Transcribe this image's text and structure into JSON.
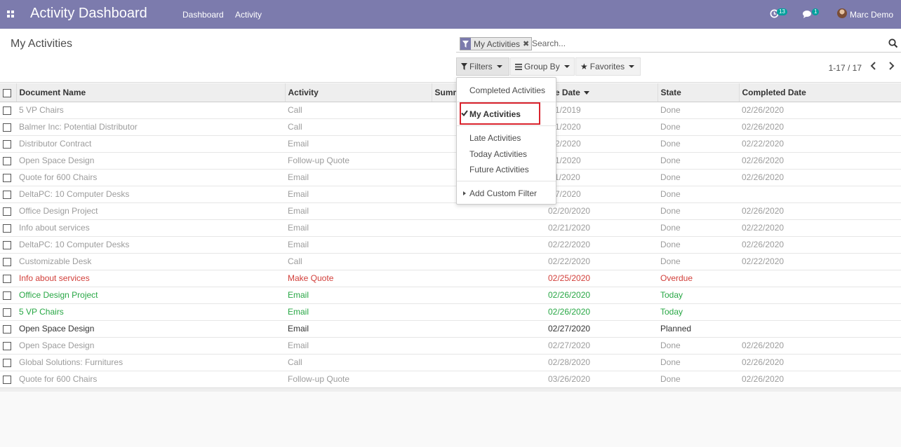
{
  "app": {
    "title": "Activity Dashboard",
    "nav": [
      "Dashboard",
      "Activity"
    ],
    "activity_count": "13",
    "message_count": "1",
    "user_name": "Marc Demo"
  },
  "control_panel": {
    "breadcrumb": "My Activities",
    "search": {
      "facet": "My Activities",
      "placeholder": "Search..."
    },
    "buttons": {
      "filters": "Filters",
      "group_by": "Group By",
      "favorites": "Favorites"
    },
    "pager": "1-17 / 17"
  },
  "filters_menu": {
    "items": [
      "Completed Activities",
      "My Activities",
      "Late Activities",
      "Today Activities",
      "Future Activities",
      "Add Custom Filter"
    ],
    "highlight_color": "#d9232d"
  },
  "table": {
    "columns": [
      "Document Name",
      "Activity",
      "Summ",
      "ue Date",
      "State",
      "Completed Date"
    ],
    "rows": [
      {
        "status": "done",
        "doc": "5 VP Chairs",
        "activity": "Call",
        "summary": "",
        "due": "/01/2019",
        "state": "Done",
        "completed": "02/26/2020"
      },
      {
        "status": "done",
        "doc": "Balmer Inc: Potential Distributor",
        "activity": "Call",
        "summary": "",
        "due": "/01/2020",
        "state": "Done",
        "completed": "02/26/2020"
      },
      {
        "status": "done",
        "doc": "Distributor Contract",
        "activity": "Email",
        "summary": "",
        "due": "/22/2020",
        "state": "Done",
        "completed": "02/22/2020"
      },
      {
        "status": "done",
        "doc": "Open Space Design",
        "activity": "Follow-up Quote",
        "summary": "",
        "due": "/01/2020",
        "state": "Done",
        "completed": "02/26/2020"
      },
      {
        "status": "done",
        "doc": "Quote for 600 Chairs",
        "activity": "Email",
        "summary": "",
        "due": "/11/2020",
        "state": "Done",
        "completed": "02/26/2020"
      },
      {
        "status": "done",
        "doc": "DeltaPC: 10 Computer Desks",
        "activity": "Email",
        "summary": "",
        "due": "/17/2020",
        "state": "Done",
        "completed": ""
      },
      {
        "status": "done",
        "doc": "Office Design Project",
        "activity": "Email",
        "summary": "",
        "due": "02/20/2020",
        "state": "Done",
        "completed": "02/26/2020"
      },
      {
        "status": "done",
        "doc": "Info about services",
        "activity": "Email",
        "summary": "",
        "due": "02/21/2020",
        "state": "Done",
        "completed": "02/22/2020"
      },
      {
        "status": "done",
        "doc": "DeltaPC: 10 Computer Desks",
        "activity": "Email",
        "summary": "",
        "due": "02/22/2020",
        "state": "Done",
        "completed": "02/26/2020"
      },
      {
        "status": "done",
        "doc": "Customizable Desk",
        "activity": "Call",
        "summary": "",
        "due": "02/22/2020",
        "state": "Done",
        "completed": "02/22/2020"
      },
      {
        "status": "overdue",
        "doc": "Info about services",
        "activity": "Make Quote",
        "summary": "",
        "due": "02/25/2020",
        "state": "Overdue",
        "completed": ""
      },
      {
        "status": "today",
        "doc": "Office Design Project",
        "activity": "Email",
        "summary": "",
        "due": "02/26/2020",
        "state": "Today",
        "completed": ""
      },
      {
        "status": "today",
        "doc": "5 VP Chairs",
        "activity": "Email",
        "summary": "",
        "due": "02/26/2020",
        "state": "Today",
        "completed": ""
      },
      {
        "status": "planned",
        "doc": "Open Space Design",
        "activity": "Email",
        "summary": "",
        "due": "02/27/2020",
        "state": "Planned",
        "completed": ""
      },
      {
        "status": "done",
        "doc": "Open Space Design",
        "activity": "Email",
        "summary": "",
        "due": "02/27/2020",
        "state": "Done",
        "completed": "02/26/2020"
      },
      {
        "status": "done",
        "doc": "Global Solutions: Furnitures",
        "activity": "Call",
        "summary": "",
        "due": "02/28/2020",
        "state": "Done",
        "completed": "02/26/2020"
      },
      {
        "status": "done",
        "doc": "Quote for 600 Chairs",
        "activity": "Follow-up Quote",
        "summary": "",
        "due": "03/26/2020",
        "state": "Done",
        "completed": "02/26/2020"
      }
    ]
  },
  "colors": {
    "navbar": "#7c7bad",
    "badge": "#00a09d",
    "overdue": "#d23f3a",
    "today": "#28a745",
    "done": "#9c9c9c"
  },
  "icons": {
    "apps": "apps-grid-icon",
    "activity": "clock-icon",
    "messages": "chat-bubble-icon",
    "filter": "funnel-icon",
    "remove": "close-icon",
    "search": "magnifier-icon",
    "group_by": "list-icon",
    "favorites": "star-icon",
    "check": "checkmark-icon",
    "prev": "chevron-left-icon",
    "next": "chevron-right-icon"
  }
}
